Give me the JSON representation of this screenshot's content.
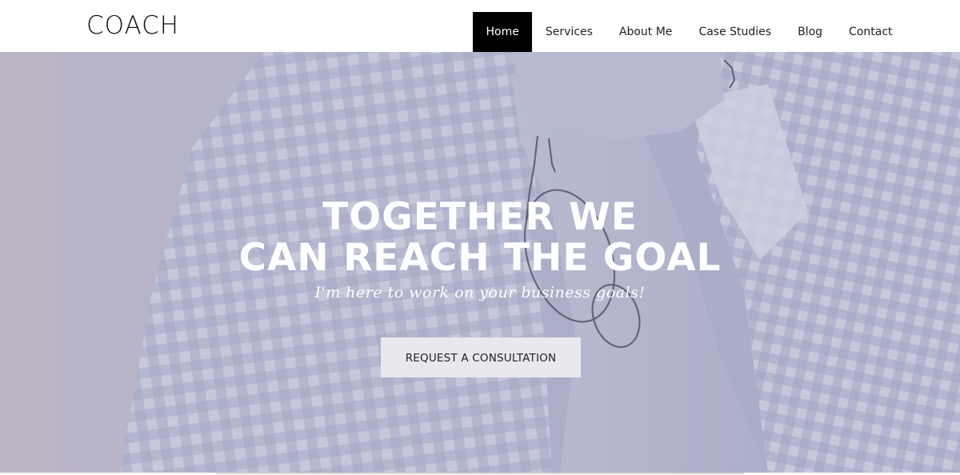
{
  "header": {
    "logo": "COACH",
    "nav": [
      {
        "label": "Home",
        "active": true
      },
      {
        "label": "Services",
        "active": false
      },
      {
        "label": "About Me",
        "active": false
      },
      {
        "label": "Case Studies",
        "active": false
      },
      {
        "label": "Blog",
        "active": false
      },
      {
        "label": "Contact",
        "active": false
      }
    ]
  },
  "hero": {
    "title_line1": "TOGETHER WE",
    "title_line2": "CAN REACH THE GOAL",
    "subtitle": "I'm here to work on your business goals!",
    "cta_label": "REQUEST A CONSULTATION"
  },
  "colors": {
    "nav_active_bg": "#000000",
    "nav_active_text": "#ffffff",
    "hero_text": "#ffffff",
    "cta_bg": "#e8e8ee"
  }
}
